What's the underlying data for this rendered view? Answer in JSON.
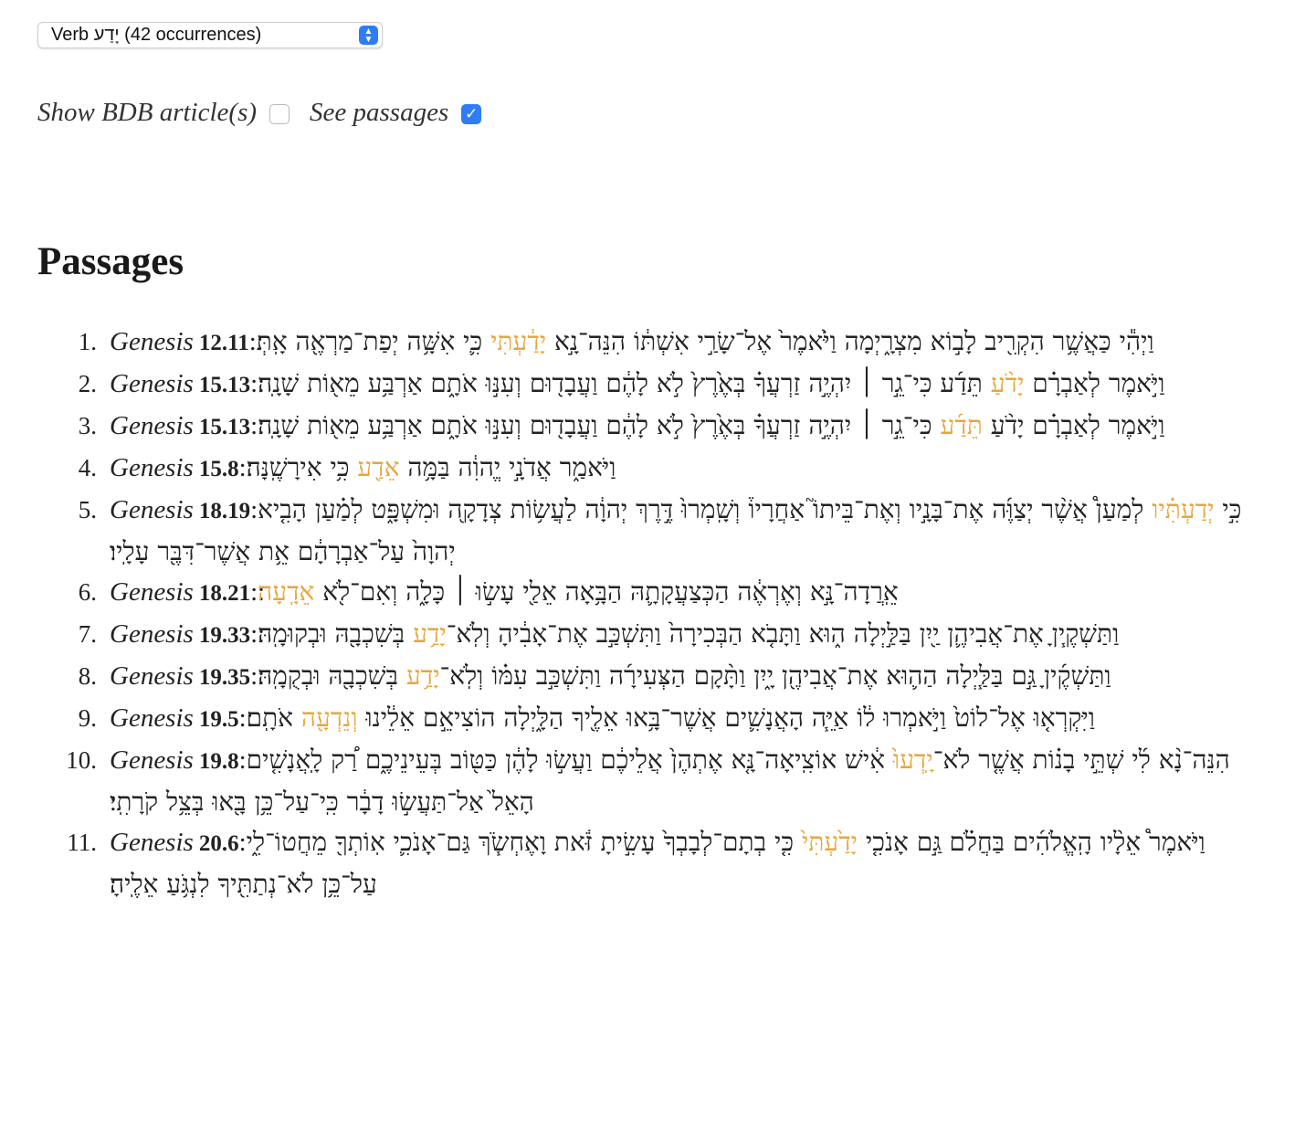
{
  "selector": {
    "value": "Verb יָדַע (42 occurrences)"
  },
  "controls": {
    "show_bdb_label": "Show BDB article(s)",
    "show_bdb_checked": false,
    "see_passages_label": "See passages",
    "see_passages_checked": true
  },
  "heading": "Passages",
  "colors": {
    "highlight": "#e8a63a",
    "accent": "#2f7df6"
  },
  "passages": [
    {
      "num": "1.",
      "book": "Genesis",
      "ref": "12.11",
      "before": "וַיְהִ֕י כַּאֲשֶׁ֥ר הִקְרִ֖יב לָב֣וֹא מִצְרָ֑יְמָה וַיֹּ֙אמֶר֙ אֶל־שָׂרַ֣י אִשְׁתּ֔וֹ הִנֵּה־נָ֣א ",
      "hl": "יָדַ֔עְתִּי",
      "after": " כִּ֛י אִשָּׁ֥ה יְפַת־מַרְאֶ֖ה אָֽתְּ׃"
    },
    {
      "num": "2.",
      "book": "Genesis",
      "ref": "15.13",
      "before": "וַיֹּ֣אמֶר לְאַבְרָ֗ם ",
      "hl": "יָדֹ֨עַ",
      "after": " תֵּדַ֜ע כִּי־גֵ֣ר ׀ יִהְיֶ֣ה זַרְעֲךָ֗ בְּאֶ֙רֶץ֙ לֹ֣א לָהֶ֔ם וַעֲבָד֖וּם וְעִנּ֣וּ אֹתָ֑ם אַרְבַּ֥ע מֵא֖וֹת שָׁנָֽה׃"
    },
    {
      "num": "3.",
      "book": "Genesis",
      "ref": "15.13",
      "before": "וַיֹּ֣אמֶר לְאַבְרָ֗ם יָדֹ֨עַ ",
      "hl": "תֵּדַ֜ע",
      "after": " כִּי־גֵ֣ר ׀ יִהְיֶ֣ה זַרְעֲךָ֗ בְּאֶ֙רֶץ֙ לֹ֣א לָהֶ֔ם וַעֲבָד֖וּם וְעִנּ֣וּ אֹתָ֑ם אַרְבַּ֥ע מֵא֖וֹת שָׁנָֽה׃"
    },
    {
      "num": "4.",
      "book": "Genesis",
      "ref": "15.8",
      "before": "וַיֹּאמַ֑ר אֲדֹנָ֣י יֱהוִ֔ה בַּמָּ֥ה ",
      "hl": "אֵדַ֖ע",
      "after": " כִּ֥י אִירָשֶֽׁנָּה׃"
    },
    {
      "num": "5.",
      "book": "Genesis",
      "ref": "18.19",
      "before": "כִּ֣י ",
      "hl": "יְדַעְתִּ֗יו",
      "after": " לְמַעַן֩ אֲשֶׁ֨ר יְצַוֶּ֜ה אֶת־בָּנָ֣יו וְאֶת־בֵּיתוֹ֮ אַחֲרָיו֒ וְשָֽׁמְרוּ֙ דֶּ֣רֶךְ יְהוָ֔ה לַעֲשׂ֥וֹת צְדָקָ֖ה וּמִשְׁפָּ֑ט לְמַ֗עַן הָבִ֤יא יְהוָה֙ עַל־אַבְרָהָ֔ם אֵ֥ת אֲשֶׁר־דִּבֶּ֖ר עָלָֽיו׃"
    },
    {
      "num": "6.",
      "book": "Genesis",
      "ref": "18.21",
      "before": "אֵֽרֲדָה־נָּ֣א וְאֶרְאֶ֔ה הַכְּצַעֲקָתָ֛הּ הַבָּ֥אָה אֵלַ֖י עָשׂ֣וּ ׀ כָּלָ֑ה וְאִם־לֹ֖א ",
      "hl": "אֵדָֽעָה",
      "after": "׃"
    },
    {
      "num": "7.",
      "book": "Genesis",
      "ref": "19.33",
      "before": "וַתַּשְׁקֶ֧יןָ אֶת־אֲבִיהֶ֛ן יַ֖יִן בַּלַּ֣יְלָה ה֑וּא וַתָּבֹ֤א הַבְּכִירָה֙ וַתִּשְׁכַּ֣ב אֶת־אָבִ֔יהָ וְלֹֽא־",
      "hl": "יָדַ֥ע",
      "after": " בְּשִׁכְבָ֖הּ וּבְקוּמָֽהּ׃"
    },
    {
      "num": "8.",
      "book": "Genesis",
      "ref": "19.35",
      "before": "וַתַּשְׁקֶ֜יןָ גַּ֣ם בַּלַּ֧יְלָה הַה֛וּא אֶת־אֲבִיהֶ֖ן יָ֑יִן וַתָּ֨קָם הַצְּעִירָ֜ה וַתִּשְׁכַּ֣ב עִמּ֗וֹ וְלֹֽא־",
      "hl": "יָדַ֥ע",
      "after": " בְּשִׁכְבָ֖הּ וּבְקֻמָֽהּ׃"
    },
    {
      "num": "9.",
      "book": "Genesis",
      "ref": "19.5",
      "before": "וַיִּקְרְא֤וּ אֶל־לוֹט֙ וַיֹּ֣אמְרוּ ל֔וֹ אַיֵּ֧ה הָאֲנָשִׁ֛ים אֲשֶׁר־בָּ֥אוּ אֵלֶ֖יךָ הַלָּ֑יְלָה הוֹצִיאֵ֣ם אֵלֵ֔ינוּ ",
      "hl": "וְנֵדְעָ֖ה",
      "after": " אֹתָֽם׃"
    },
    {
      "num": "10.",
      "book": "Genesis",
      "ref": "19.8",
      "before": "הִנֵּה־נָ֨א לִ֜י שְׁתֵּ֣י בָנ֗וֹת אֲשֶׁ֤ר לֹא־",
      "hl": "יָֽדְעוּ֙",
      "after": " אִ֔ישׁ אוֹצִֽיאָה־נָּ֤א אֶתְהֶן֙ אֲלֵיכֶ֔ם וַעֲשׂ֣וּ לָהֶ֔ן כַּטּ֖וֹב בְּעֵינֵיכֶ֑ם רַ֠ק לָֽאֲנָשִׁ֤ים הָאֵל֙ אַל־תַּעֲשׂ֣וּ דָבָ֔ר כִּֽי־עַל־כֵּ֥ן בָּ֖אוּ בְּצֵ֥ל קֹרָתִֽי׃"
    },
    {
      "num": "11.",
      "book": "Genesis",
      "ref": "20.6",
      "before": "וַיֹּאמֶר֩ אֵלָ֨יו הָֽאֱלֹהִ֜ים בַּחֲלֹ֗ם גַּ֣ם אָנֹכִ֤י ",
      "hl": "יָדַ֙עְתִּי֙",
      "after": " כִּ֤י בְתָם־לְבָבְךָ֙ עָשִׂ֣יתָ זֹּ֔את וָאֶחְשֹׂ֧ךְ גַּם־אָנֹכִ֛י אֽוֹתְךָ֖ מֵחֲטוֹ־לִ֑י עַל־כֵּ֥ן לֹא־נְתַתִּ֖יךָ לִנְגֹּ֥עַ אֵלֶֽיהָ׃"
    }
  ]
}
